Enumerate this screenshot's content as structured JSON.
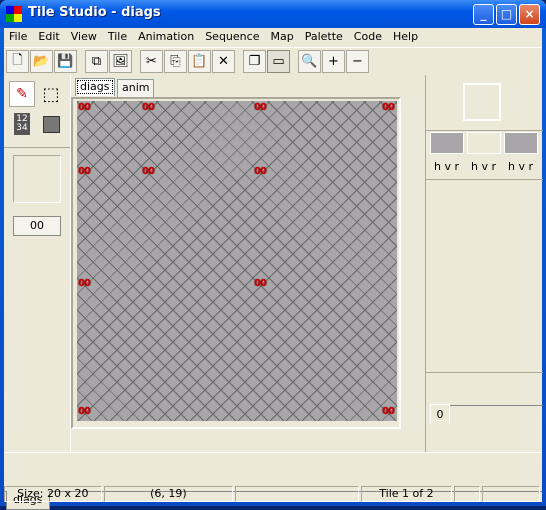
{
  "window": {
    "title": "Tile Studio - diags",
    "minimize": "_",
    "maximize": "□",
    "close": "×"
  },
  "menu": [
    "File",
    "Edit",
    "View",
    "Tile",
    "Animation",
    "Sequence",
    "Map",
    "Palette",
    "Code",
    "Help"
  ],
  "toolbar": [
    {
      "name": "new-icon",
      "glyph": "🗋"
    },
    {
      "name": "open-icon",
      "glyph": "📂"
    },
    {
      "name": "save-icon",
      "glyph": "💾"
    },
    null,
    {
      "name": "copy-tile-icon",
      "glyph": "⧉"
    },
    {
      "name": "import-icon",
      "glyph": "🖼"
    },
    null,
    {
      "name": "cut-icon",
      "glyph": "✂"
    },
    {
      "name": "copy-icon",
      "glyph": "⎘"
    },
    {
      "name": "paste-icon",
      "glyph": "📋"
    },
    {
      "name": "delete-icon",
      "glyph": "✕"
    },
    null,
    {
      "name": "overlap-icon",
      "glyph": "❐"
    },
    {
      "name": "bounds-icon",
      "glyph": "▭",
      "pressed": true
    },
    null,
    {
      "name": "zoom-icon",
      "glyph": "🔍"
    },
    {
      "name": "zoom-in-icon",
      "glyph": "+"
    },
    {
      "name": "zoom-out-icon",
      "glyph": "−"
    }
  ],
  "left": {
    "tile_value": "00"
  },
  "tabs": [
    "diags",
    "anim"
  ],
  "map": {
    "cols": 20,
    "rows": 20,
    "marker_label": "00",
    "marker_color": "#cc0000",
    "markers": [
      [
        0,
        0
      ],
      [
        0,
        4
      ],
      [
        0,
        11
      ],
      [
        0,
        19
      ],
      [
        4,
        0
      ],
      [
        4,
        4
      ],
      [
        4,
        11
      ],
      [
        11,
        0
      ],
      [
        11,
        11
      ],
      [
        19,
        0
      ],
      [
        19,
        19
      ]
    ]
  },
  "right": {
    "flags": [
      "h v r",
      "h v r",
      "h v r"
    ],
    "sequence_tab": "0"
  },
  "tile_sets": [
    "diags"
  ],
  "status": {
    "size": "Size: 20 x 20",
    "cursor": "(6, 19)",
    "blank": "",
    "tile": "Tile 1 of 2"
  }
}
